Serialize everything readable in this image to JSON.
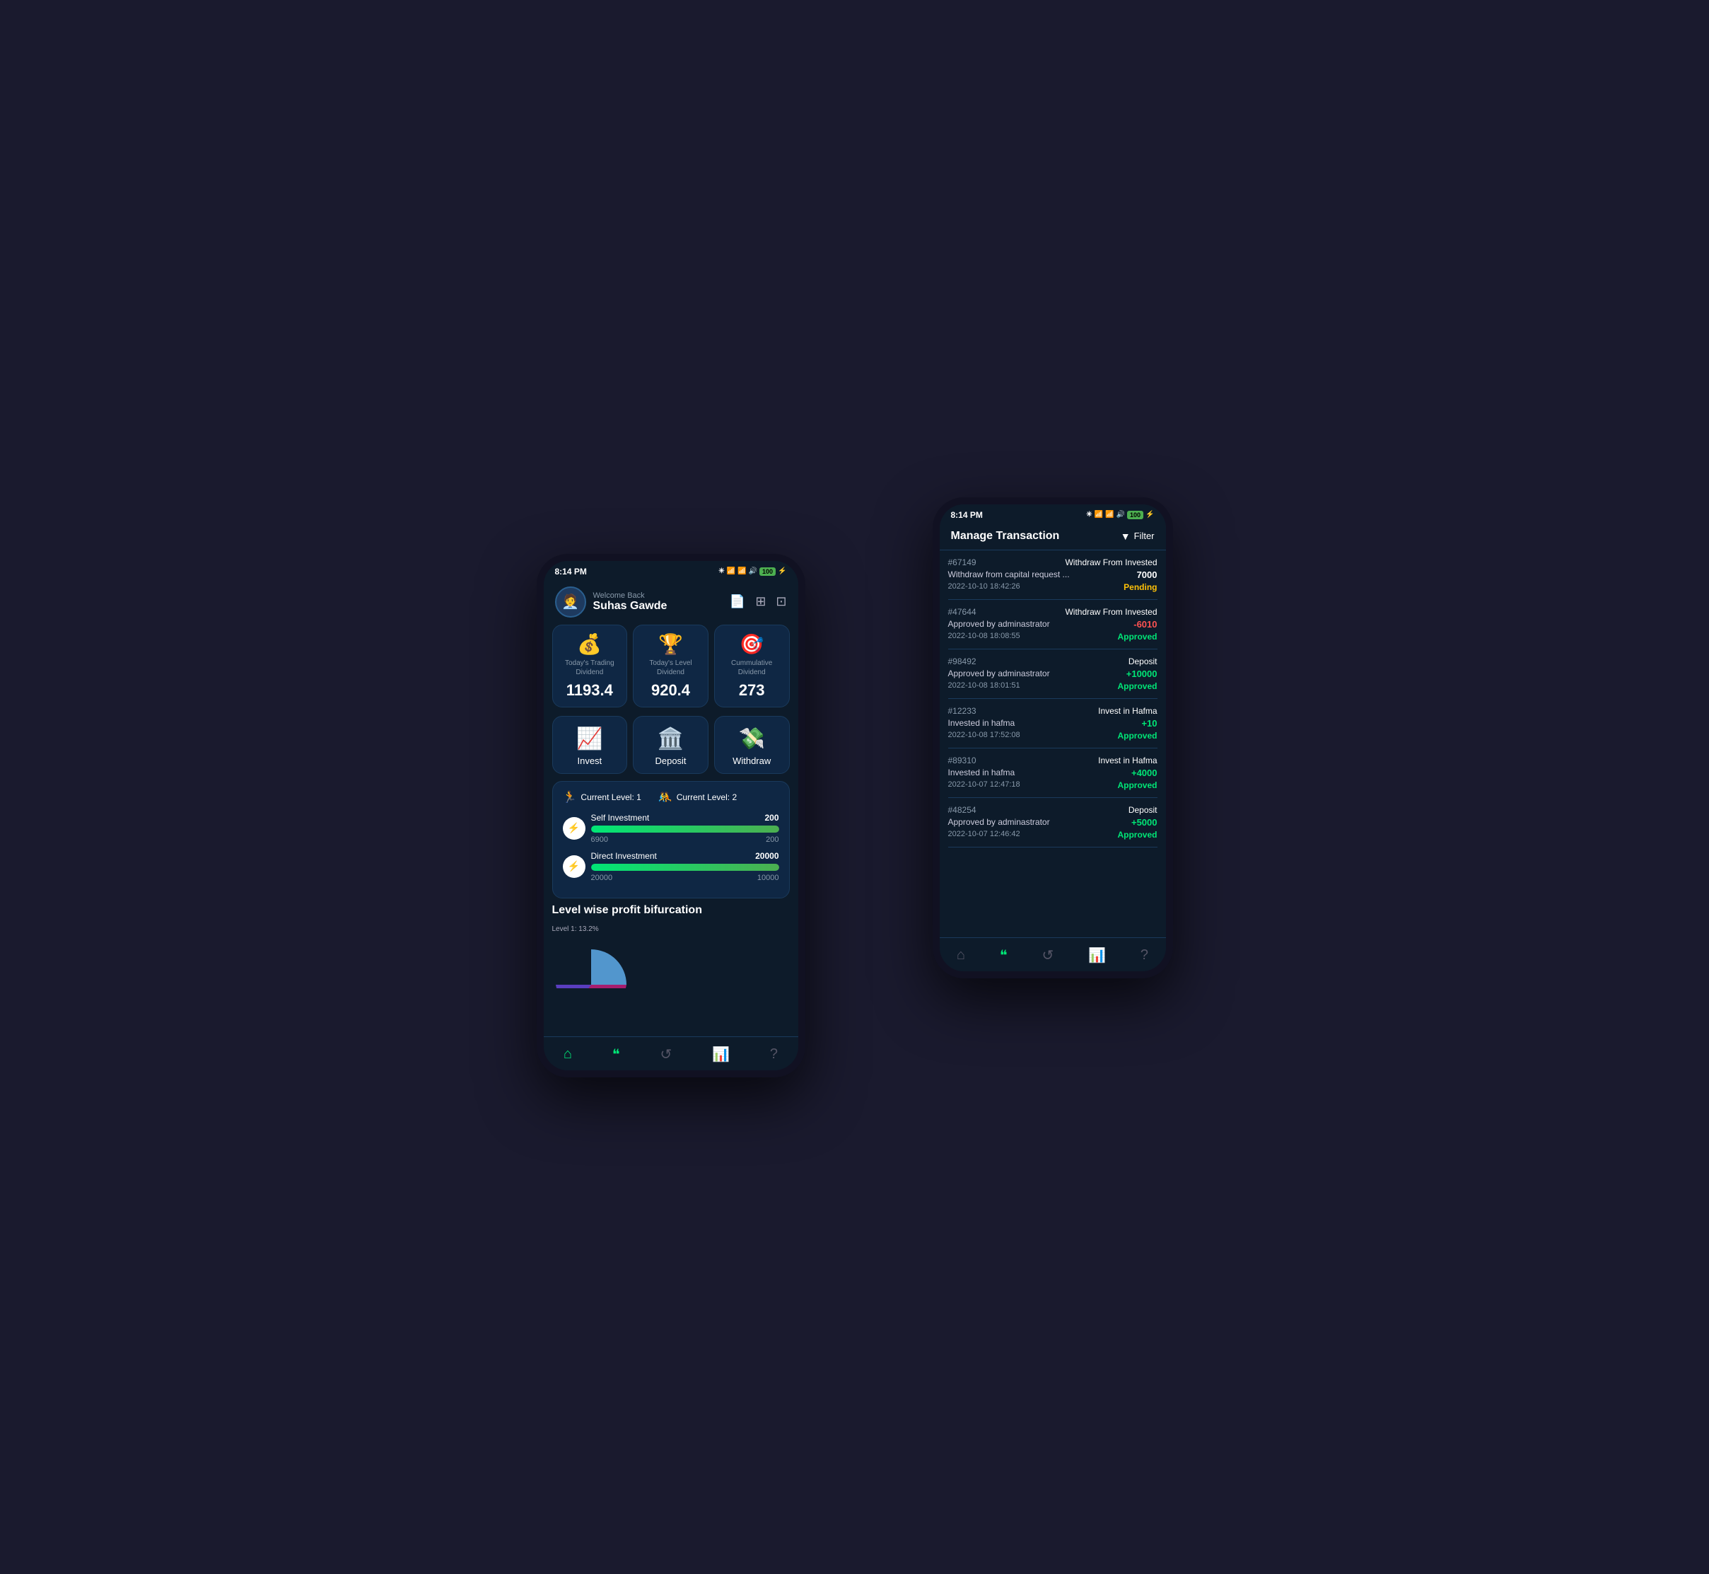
{
  "left_phone": {
    "status": {
      "time": "8:14 PM",
      "icons": "✗ 🔊",
      "battery": "100"
    },
    "header": {
      "welcome": "Welcome Back",
      "user_name": "Suhas Gawde",
      "avatar_emoji": "👔"
    },
    "dividends": [
      {
        "icon": "💰",
        "label": "Today's Trading Dividend",
        "value": "1193.4"
      },
      {
        "icon": "🏆",
        "label": "Today's Level Dividend",
        "value": "920.4"
      },
      {
        "icon": "🎯",
        "label": "Cummulative Dividend",
        "value": "273"
      }
    ],
    "actions": [
      {
        "icon": "📈",
        "label": "Invest"
      },
      {
        "icon": "🏛️",
        "label": "Deposit"
      },
      {
        "icon": "💸",
        "label": "Withdraw"
      }
    ],
    "levels": {
      "current_level_1": "Current Level: 1",
      "current_level_2": "Current Level: 2",
      "self_investment": {
        "label": "Self Investment",
        "target": 200,
        "current": 6900,
        "max": 200,
        "progress_pct": 100
      },
      "direct_investment": {
        "label": "Direct Investment",
        "target": 20000,
        "current": 20000,
        "max": 10000,
        "progress_pct": 100
      }
    },
    "profit_section": {
      "title": "Level wise profit bifurcation",
      "chart_label": "Level 1: 13.2%"
    },
    "nav": [
      {
        "icon": "🏠",
        "label": "home",
        "active": true
      },
      {
        "icon": "💬",
        "label": "chat",
        "active": false
      },
      {
        "icon": "🔄",
        "label": "history",
        "active": false
      },
      {
        "icon": "📊",
        "label": "stats",
        "active": false
      },
      {
        "icon": "❓",
        "label": "help",
        "active": false
      }
    ]
  },
  "right_phone": {
    "status": {
      "time": "8:14 PM",
      "battery": "100"
    },
    "header": {
      "title": "Manage Transaction",
      "filter_label": "Filter"
    },
    "transactions": [
      {
        "id": "#67149",
        "type": "Withdraw From Invested",
        "desc": "Withdraw from capital request ...",
        "amount": "7000",
        "amount_class": "amount-neutral",
        "date": "2022-10-10 18:42:26",
        "status": "Pending",
        "status_class": "status-pending"
      },
      {
        "id": "#47644",
        "type": "Withdraw From Invested",
        "desc": "Approved by adminastrator",
        "amount": "-6010",
        "amount_class": "amount-negative",
        "date": "2022-10-08 18:08:55",
        "status": "Approved",
        "status_class": "status-approved"
      },
      {
        "id": "#98492",
        "type": "Deposit",
        "desc": "Approved by adminastrator",
        "amount": "+10000",
        "amount_class": "amount-positive",
        "date": "2022-10-08 18:01:51",
        "status": "Approved",
        "status_class": "status-approved"
      },
      {
        "id": "#12233",
        "type": "Invest in Hafma",
        "desc": "Invested in hafma",
        "amount": "+10",
        "amount_class": "amount-positive",
        "date": "2022-10-08 17:52:08",
        "status": "Approved",
        "status_class": "status-approved"
      },
      {
        "id": "#89310",
        "type": "Invest in Hafma",
        "desc": "Invested in hafma",
        "amount": "+4000",
        "amount_class": "amount-positive",
        "date": "2022-10-07 12:47:18",
        "status": "Approved",
        "status_class": "status-approved"
      },
      {
        "id": "#48254",
        "type": "Deposit",
        "desc": "Approved by adminastrator",
        "amount": "+5000",
        "amount_class": "amount-positive",
        "date": "2022-10-07 12:46:42",
        "status": "Approved",
        "status_class": "status-approved"
      }
    ],
    "nav": [
      {
        "icon": "🏠",
        "label": "home",
        "active": false
      },
      {
        "icon": "💬",
        "label": "chat",
        "active": false
      },
      {
        "icon": "🔄",
        "label": "history",
        "active": false
      },
      {
        "icon": "📊",
        "label": "stats",
        "active": false
      },
      {
        "icon": "❓",
        "label": "help",
        "active": false
      }
    ]
  }
}
